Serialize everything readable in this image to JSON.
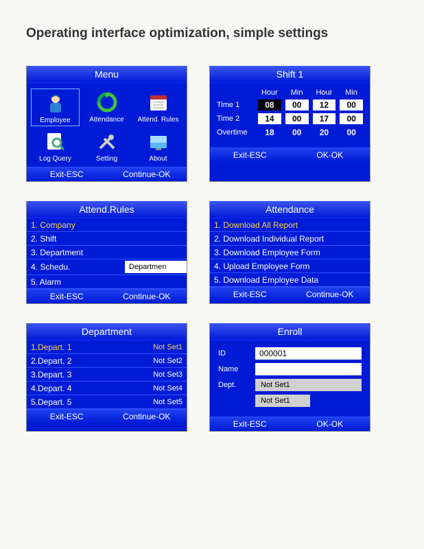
{
  "heading": "Operating interface optimization, simple settings",
  "menu": {
    "title": "Menu",
    "icons": [
      {
        "label": "Employee"
      },
      {
        "label": "Attendance"
      },
      {
        "label": "Attend. Rules"
      },
      {
        "label": "Log Query"
      },
      {
        "label": "Setting"
      },
      {
        "label": "About"
      }
    ],
    "footer_left": "Exit-ESC",
    "footer_right": "Continue-OK"
  },
  "shift": {
    "title": "Shift 1",
    "headers": [
      "Hour",
      "Min",
      "Hour",
      "Min"
    ],
    "rows": [
      {
        "label": "Time 1",
        "v": [
          "08",
          "00",
          "12",
          "00"
        ]
      },
      {
        "label": "Time 2",
        "v": [
          "14",
          "00",
          "17",
          "00"
        ]
      },
      {
        "label": "Overtime",
        "v": [
          "18",
          "00",
          "20",
          "00"
        ]
      }
    ],
    "footer_left": "Exit-ESC",
    "footer_right": "OK-OK"
  },
  "attend_rules": {
    "title": "Attend.Rules",
    "items": [
      "1. Company",
      "2. Shift",
      "3. Department",
      "4. Schedu.",
      "5. Alarm"
    ],
    "popup": "Departmen",
    "footer_left": "Exit-ESC",
    "footer_right": "Continue-OK"
  },
  "attendance": {
    "title": "Attendance",
    "items": [
      "1. Download All Report",
      "2. Download Individual Report",
      "3. Download Employee Form",
      "4. Upload Employee Form",
      "5. Download Employee Data"
    ],
    "footer_left": "Exit-ESC",
    "footer_right": "Continue-OK"
  },
  "department": {
    "title": "Department",
    "rows": [
      {
        "label": "1.Depart. 1",
        "val": "Not Set1"
      },
      {
        "label": "2.Depart. 2",
        "val": "Not Set2"
      },
      {
        "label": "3.Depart. 3",
        "val": "Not Set3"
      },
      {
        "label": "4.Depart. 4",
        "val": "Not Set4"
      },
      {
        "label": "5.Depart. 5",
        "val": "Not Set5"
      }
    ],
    "footer_left": "Exit-ESC",
    "footer_right": "Continue-OK"
  },
  "enroll": {
    "title": "Enroll",
    "id_label": "ID",
    "id_value": "000001",
    "name_label": "Name",
    "name_value": "",
    "dept_label": "Dept.",
    "dept_value": "Not Set1",
    "btn": "Not Set1",
    "footer_left": "Exit-ESC",
    "footer_right": "OK-OK"
  }
}
